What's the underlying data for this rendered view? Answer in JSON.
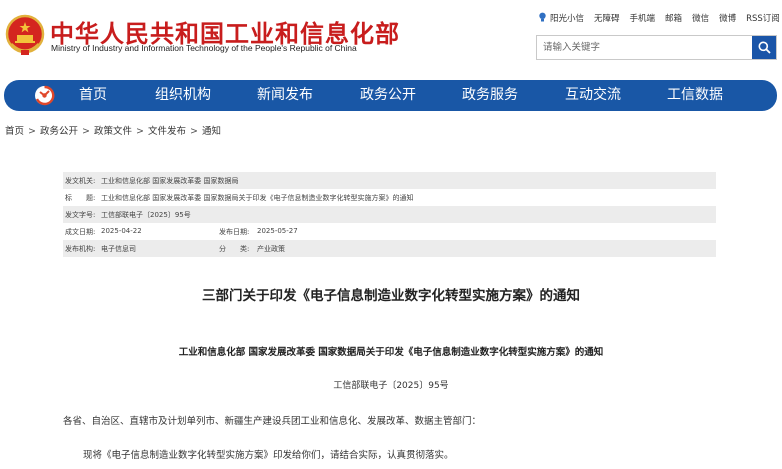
{
  "header": {
    "title": "中华人民共和国工业和信息化部",
    "subtitle": "Ministry of Industry and Information Technology of the People's Republic of China",
    "links": [
      "阳光小信",
      "无障碍",
      "手机端",
      "邮箱",
      "微信",
      "微博",
      "RSS订阅"
    ]
  },
  "search": {
    "placeholder": "请输入关键字"
  },
  "nav": {
    "items": [
      "首页",
      "组织机构",
      "新闻发布",
      "政务公开",
      "政务服务",
      "互动交流",
      "工信数据"
    ]
  },
  "breadcrumb": [
    "首页",
    "政务公开",
    "政策文件",
    "文件发布",
    "通知"
  ],
  "meta": {
    "issuer_label": "发文机关:",
    "issuer": "工业和信息化部 国家发展改革委 国家数据局",
    "title_label": "标　　题:",
    "title": "工业和信息化部 国家发展改革委 国家数据局关于印发《电子信息制造业数字化转型实施方案》的通知",
    "docno_label": "发文字号:",
    "docno": "工信部联电子〔2025〕95号",
    "written_label": "成文日期:",
    "written": "2025-04-22",
    "published_label": "发布日期:",
    "published": "2025-05-27",
    "org_label": "发布机构:",
    "org": "电子信息司",
    "category_label": "分　　类:",
    "category": "产业政策"
  },
  "article": {
    "title": "三部门关于印发《电子信息制造业数字化转型实施方案》的通知",
    "issuers": "工业和信息化部 国家发展改革委 国家数据局关于印发《电子信息制造业数字化转型实施方案》的通知",
    "docno": "工信部联电子〔2025〕95号",
    "para1": "各省、自治区、直辖市及计划单列市、新疆生产建设兵团工业和信息化、发展改革、数据主管部门：",
    "para2": "现将《电子信息制造业数字化转型实施方案》印发给你们，请结合实际，认真贯彻落实。"
  },
  "colors": {
    "brand_red": "#c81d1d",
    "nav_blue": "#1957a6",
    "search_blue": "#1a55a8"
  }
}
